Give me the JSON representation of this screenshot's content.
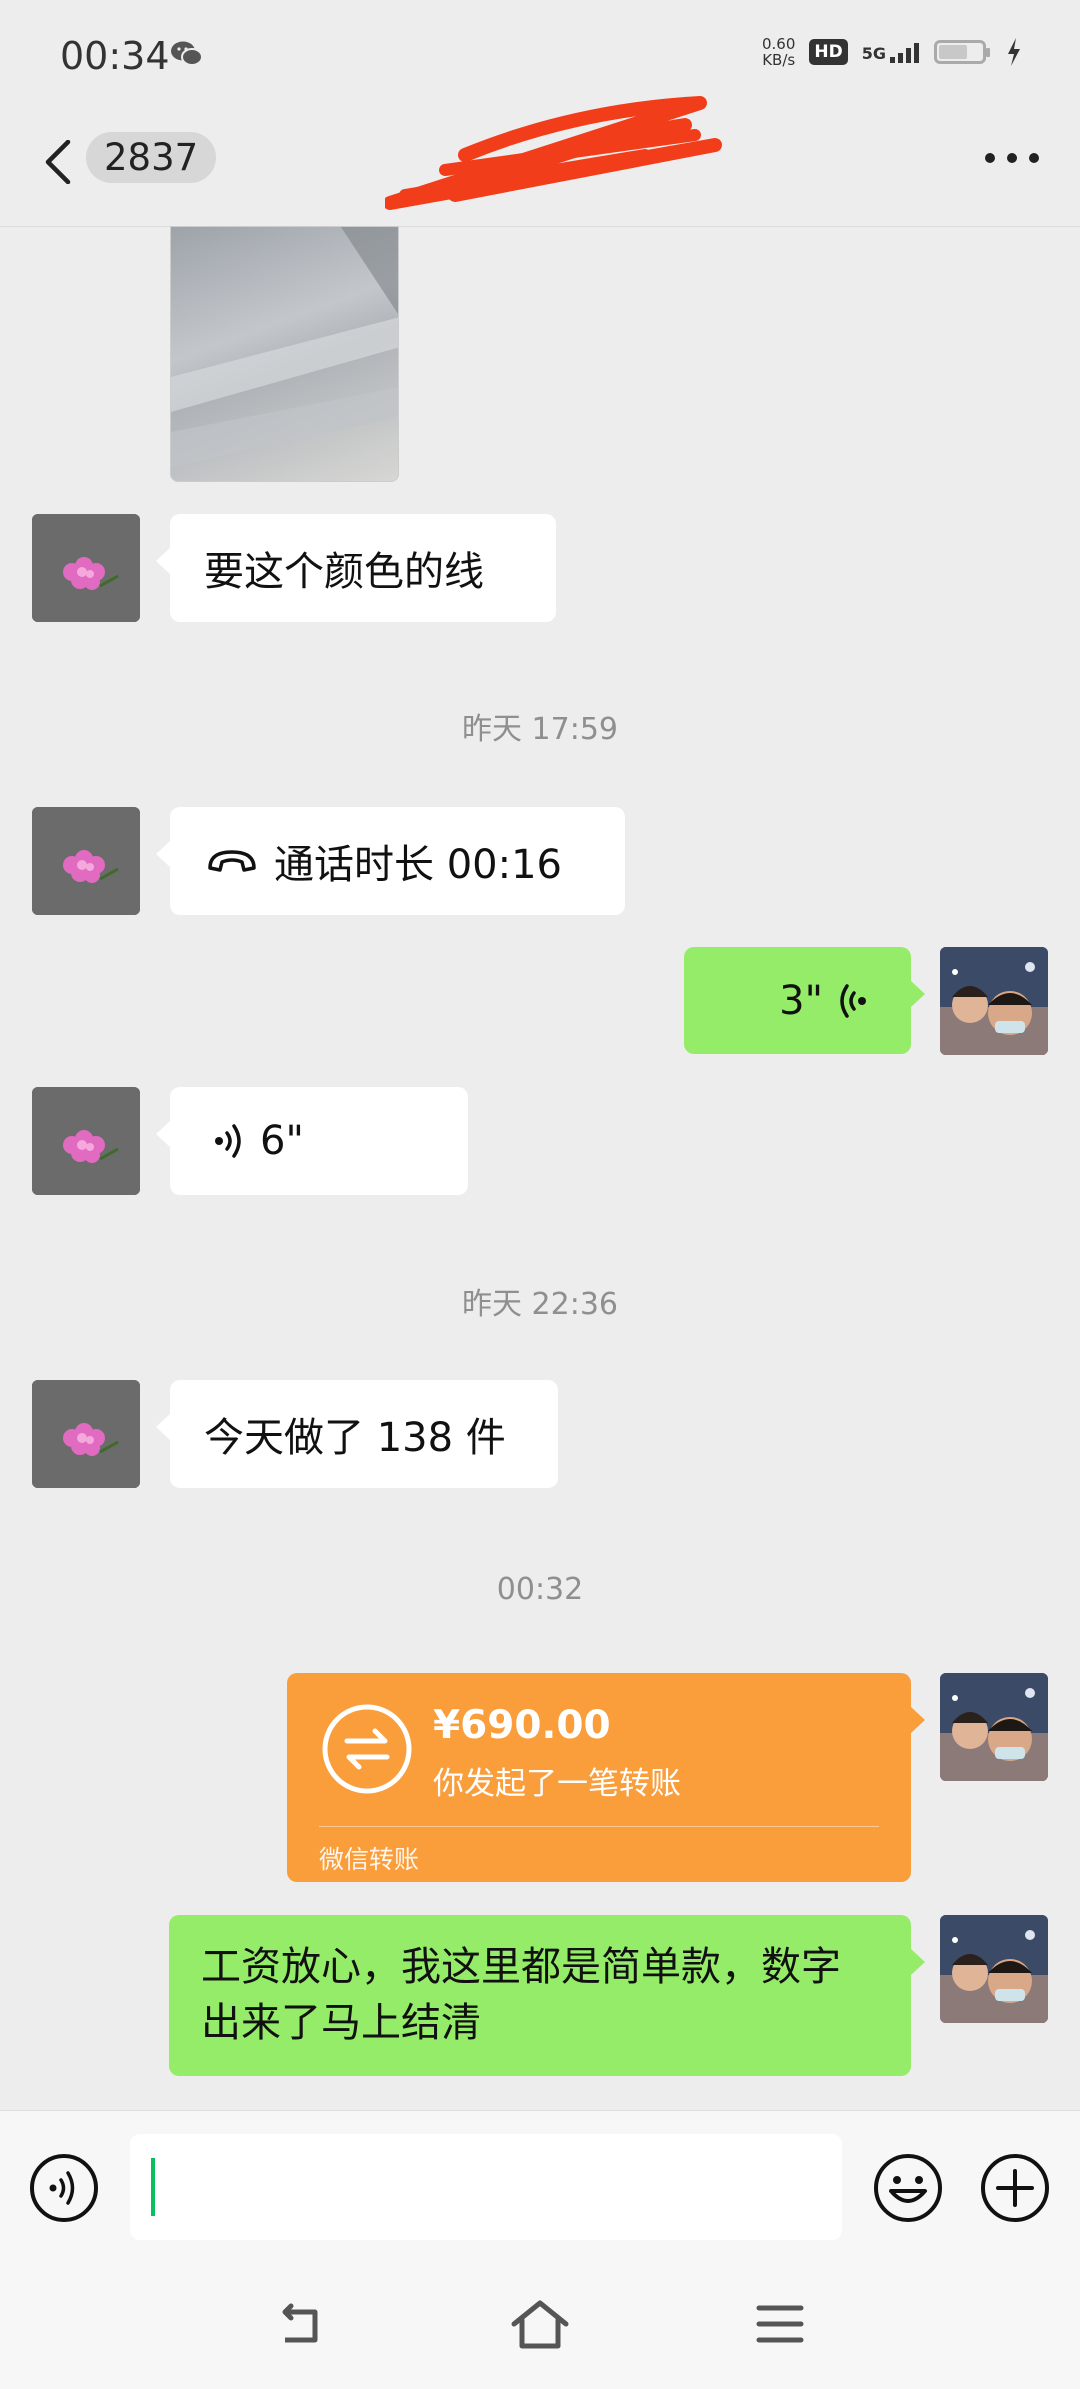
{
  "status_bar": {
    "time": "00:34",
    "net_speed_value": "0.60",
    "net_speed_unit": "KB/s",
    "hd": "HD",
    "network": "5G",
    "app_icon": "wechat-icon"
  },
  "header": {
    "unread_count": "2837",
    "back_icon": "chevron-left-icon",
    "more_icon": "more-dots-icon"
  },
  "messages": [
    {
      "type": "image",
      "side": "in"
    },
    {
      "type": "text",
      "side": "in",
      "text": "要这个颜色的线"
    },
    {
      "type": "time",
      "text": "昨天 17:59"
    },
    {
      "type": "call",
      "side": "in",
      "text": "通话时长 00:16",
      "icon": "phone-icon"
    },
    {
      "type": "voice",
      "side": "out",
      "text": "3\"",
      "icon": "voice-wave-icon"
    },
    {
      "type": "voice",
      "side": "in",
      "text": "6\"",
      "icon": "voice-wave-icon"
    },
    {
      "type": "time",
      "text": "昨天 22:36"
    },
    {
      "type": "text",
      "side": "in",
      "text": "今天做了 138 件"
    },
    {
      "type": "time",
      "text": "00:32"
    },
    {
      "type": "transfer",
      "side": "out",
      "amount": "¥690.00",
      "desc": "你发起了一笔转账",
      "footer": "微信转账",
      "icon": "transfer-arrows-icon"
    },
    {
      "type": "text",
      "side": "out",
      "text": "工资放心，我这里都是简单款，数字出来了马上结清"
    }
  ],
  "input_bar": {
    "value": "",
    "voice_icon": "voice-input-icon",
    "emoji_icon": "emoji-icon",
    "plus_icon": "plus-icon"
  },
  "nav_bar": {
    "back_icon": "nav-back-icon",
    "home_icon": "home-icon",
    "menu_icon": "menu-icon"
  },
  "colors": {
    "background": "#ededed",
    "bubble_out": "#95ec69",
    "bubble_in": "#ffffff",
    "transfer": "#fa9d3b",
    "caret": "#07c160"
  }
}
